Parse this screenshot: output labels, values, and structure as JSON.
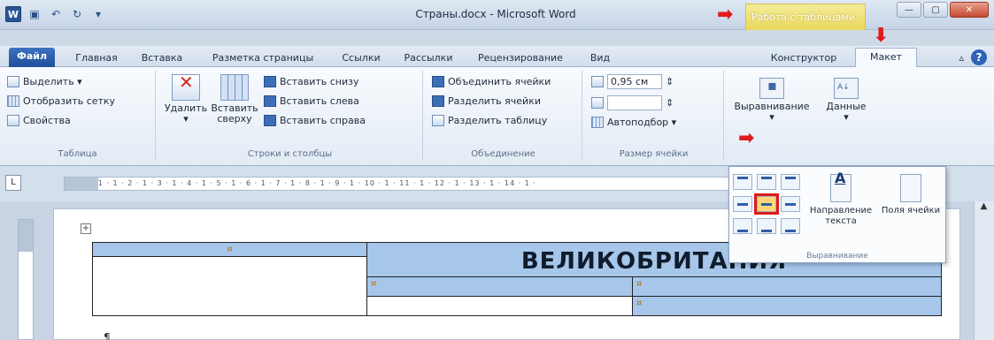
{
  "window": {
    "title": "Страны.docx - Microsoft Word",
    "contextual_tab": "Работа с таблицами",
    "qat_icons": [
      "word-icon",
      "save-icon",
      "undo-icon",
      "redo-icon",
      "customize-icon"
    ]
  },
  "tabs": [
    {
      "label": "Файл"
    },
    {
      "label": "Главная"
    },
    {
      "label": "Вставка"
    },
    {
      "label": "Разметка страницы"
    },
    {
      "label": "Ссылки"
    },
    {
      "label": "Рассылки"
    },
    {
      "label": "Рецензирование"
    },
    {
      "label": "Вид"
    },
    {
      "label": "Конструктор"
    },
    {
      "label": "Макет"
    }
  ],
  "ribbon": {
    "table": {
      "select": "Выделить ▾",
      "show_grid": "Отобразить сетку",
      "properties": "Свойства",
      "label": "Таблица"
    },
    "rows_cols": {
      "delete": "Удалить",
      "delete_arrow": "▾",
      "insert_above": "Вставить сверху",
      "insert_below": "Вставить снизу",
      "insert_left": "Вставить слева",
      "insert_right": "Вставить справа",
      "label": "Строки и столбцы"
    },
    "merge": {
      "merge_cells": "Объединить ячейки",
      "split_cells": "Разделить ячейки",
      "split_table": "Разделить таблицу",
      "label": "Объединение"
    },
    "cell_size": {
      "height_value": "0,95 см",
      "width_value": "",
      "autofit": "Автоподбор ▾",
      "label": "Размер ячейки"
    },
    "alignment": {
      "label": "Выравнивание",
      "arrow": "▾"
    },
    "data": {
      "label": "Данные",
      "arrow": "▾"
    }
  },
  "ruler": {
    "marks": "· 1 · 1 · 1 · 2 · 1 · 3 · 1 · 4 · 1 · 5 · 1 · 6 · 1 · 7 · 1 · 8 · 1 · 9 · 1 · 10 · 1 · 11 · 1 · 12 · 1 · 13 · 1 · 14 · 1 ·"
  },
  "gallery": {
    "text_direction": "Направление текста",
    "cell_margins": "Поля ячейки",
    "label": "Выравнивание",
    "selected_alignment": "middle-center"
  },
  "document": {
    "table_heading": "ВЕЛИКОБРИТАНИЯ",
    "cell_mark": "¤",
    "pilcrow": "¶",
    "move_handle": "+"
  },
  "colors": {
    "accent_red": "#e01b1b",
    "cell_selected": "#a6c6ea",
    "contextual_tab": "#e9d85a"
  }
}
